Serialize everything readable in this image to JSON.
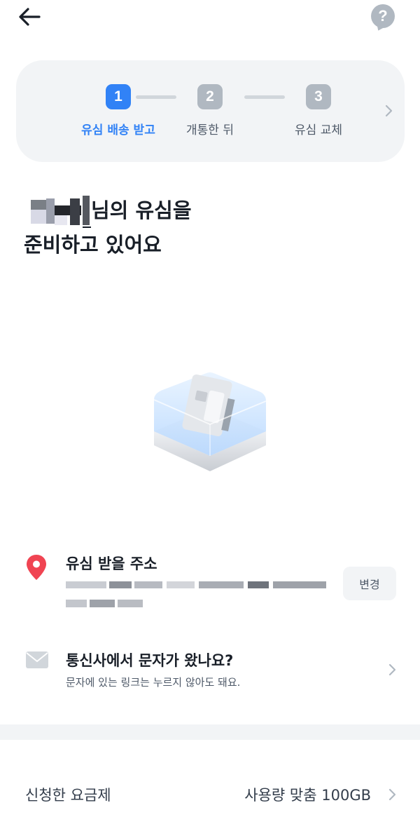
{
  "header": {
    "back_icon": "arrow-left-icon",
    "help_label": "?"
  },
  "steps": [
    {
      "number": "1",
      "label": "유심 배송 받고",
      "state": "active"
    },
    {
      "number": "2",
      "label": "개통한 뒤",
      "state": "inactive"
    },
    {
      "number": "3",
      "label": "유심 교체",
      "state": "inactive"
    }
  ],
  "headline": {
    "line1_suffix": "님의 유심을",
    "line2": "준비하고 있어요"
  },
  "address": {
    "title": "유심 받을 주소",
    "change_label": "변경"
  },
  "sms": {
    "title": "통신사에서 문자가 왔나요?",
    "subtitle": "문자에 있는 링크는 누르지 않아도 돼요."
  },
  "plan": {
    "label": "신청한 요금제",
    "value": "사용량 맞춤 100GB"
  },
  "colors": {
    "accent": "#3182f6",
    "inactive_step": "#b0b8c1",
    "panel": "#f2f4f6",
    "pin": "#f04452",
    "text": "#191f28",
    "subtext": "#4e5968"
  }
}
